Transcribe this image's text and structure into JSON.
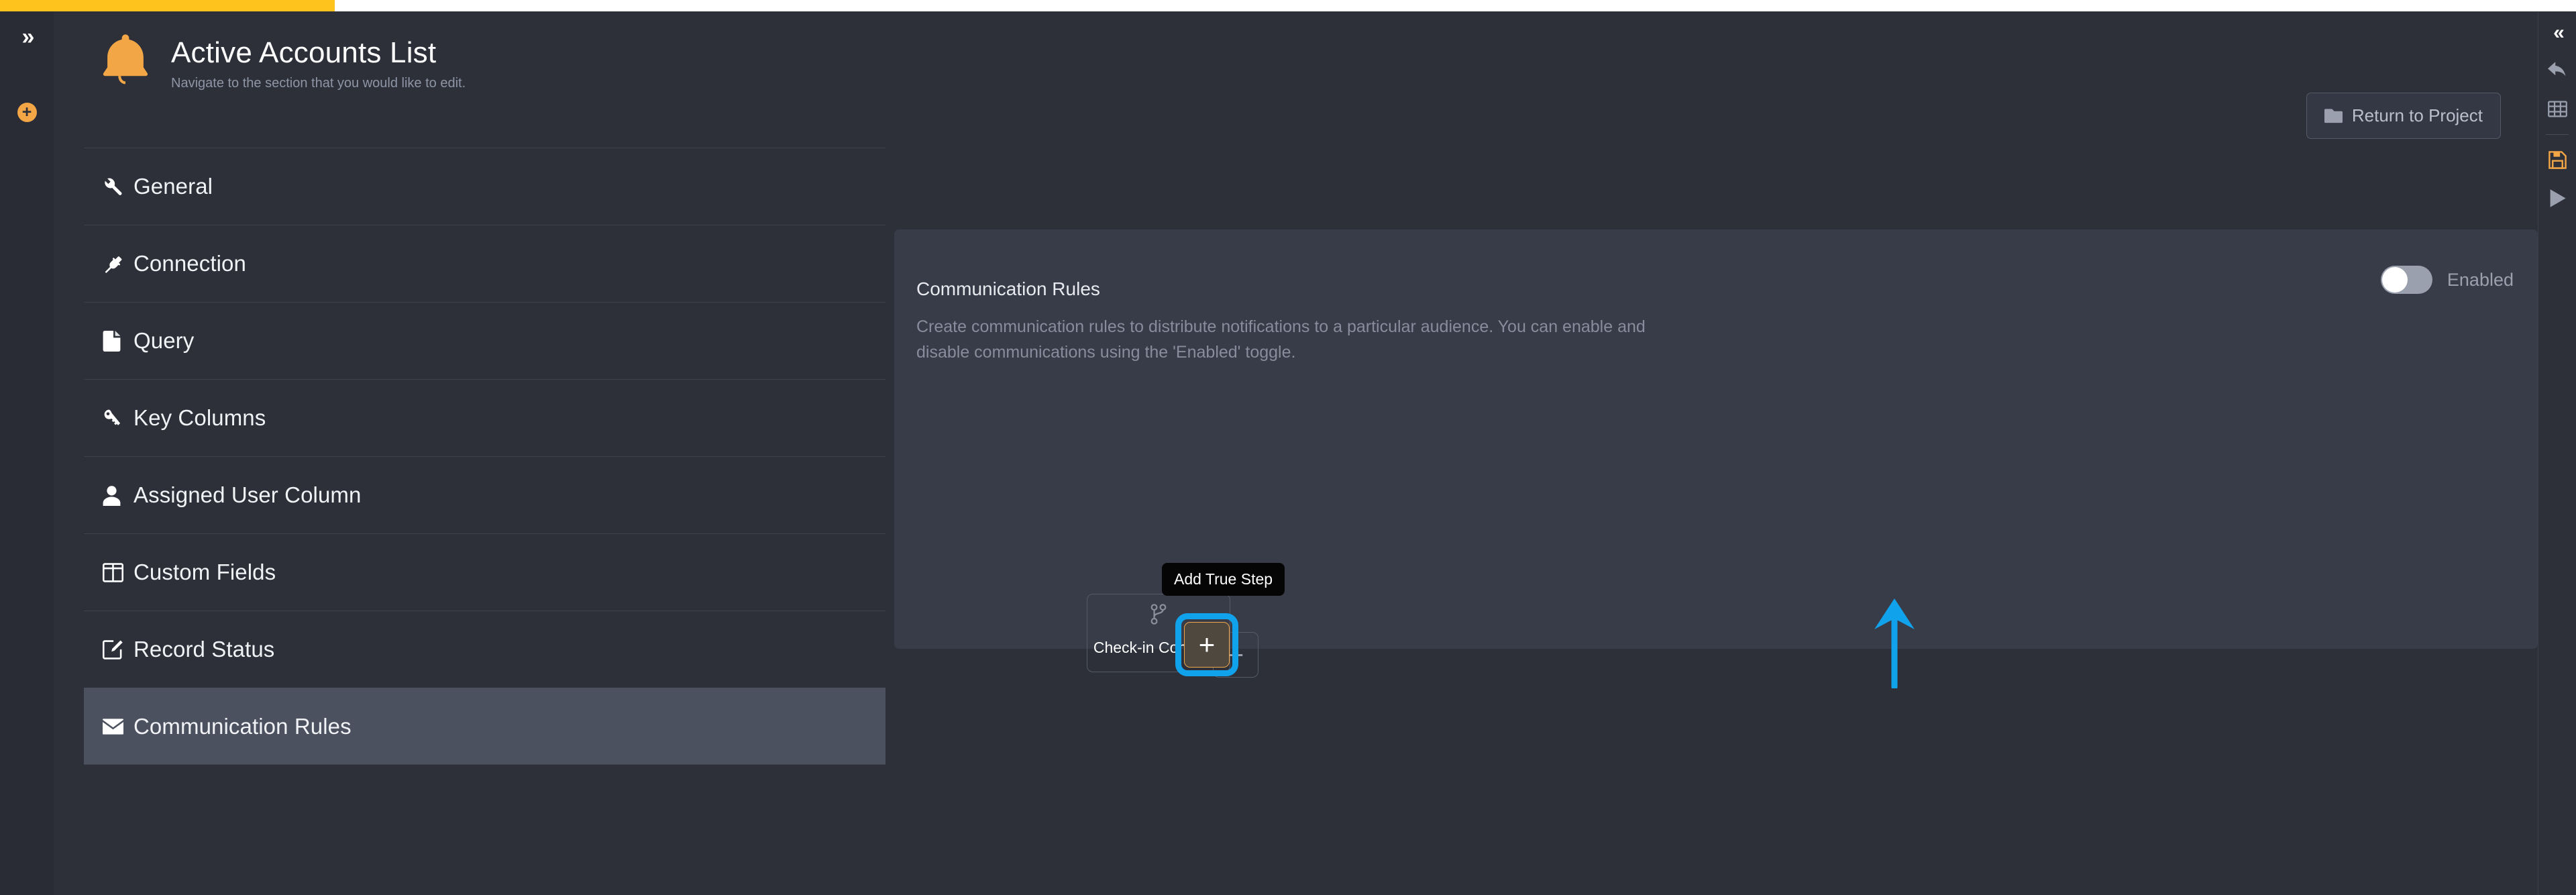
{
  "progress": {
    "percent": 13
  },
  "colors": {
    "accent_orange": "#f3a646",
    "progress_yellow": "#ffc31e",
    "highlight_blue": "#11a2ec",
    "panel_bg": "#383c48",
    "app_bg": "#2d3039",
    "selected_nav": "#4c5160"
  },
  "left_rail": {
    "expand_icon": "chevron-double-right-icon",
    "expand_glyph": "»",
    "add_icon": "circle-plus-icon",
    "add_glyph": "+"
  },
  "right_rail": {
    "items": [
      {
        "name": "collapse-panel-icon",
        "glyph": "«"
      },
      {
        "name": "undo-icon"
      },
      {
        "name": "table-grid-icon"
      },
      {
        "name": "save-icon"
      },
      {
        "name": "run-icon"
      }
    ]
  },
  "header": {
    "icon": "bell-icon",
    "title": "Active Accounts List",
    "subtitle": "Navigate to the section that you would like to edit."
  },
  "toolbar": {
    "return_label": "Return to Project",
    "return_icon": "folder-icon"
  },
  "sidebar": {
    "items": [
      {
        "label": "General",
        "icon": "wrench-icon",
        "active": false
      },
      {
        "label": "Connection",
        "icon": "plug-icon",
        "active": false
      },
      {
        "label": "Query",
        "icon": "file-icon",
        "active": false
      },
      {
        "label": "Key Columns",
        "icon": "key-icon",
        "active": false
      },
      {
        "label": "Assigned User Column",
        "icon": "user-icon",
        "active": false
      },
      {
        "label": "Custom Fields",
        "icon": "columns-icon",
        "active": false
      },
      {
        "label": "Record Status",
        "icon": "edit-square-icon",
        "active": false
      },
      {
        "label": "Communication Rules",
        "icon": "envelope-icon",
        "active": true
      }
    ]
  },
  "panel": {
    "title": "Communication Rules",
    "description": "Create communication rules to distribute notifications to a particular audience. You can enable and disable communications using the 'Enabled' toggle.",
    "toggle": {
      "label": "Enabled",
      "state": "off"
    }
  },
  "flow": {
    "condition_node": {
      "label": "Check-in Condition",
      "icon": "code-branch-icon"
    },
    "true_step_button": {
      "glyph": "+",
      "focused": true
    },
    "false_step_button": {
      "glyph": "+",
      "focused": false
    },
    "tooltip": "Add True Step"
  }
}
